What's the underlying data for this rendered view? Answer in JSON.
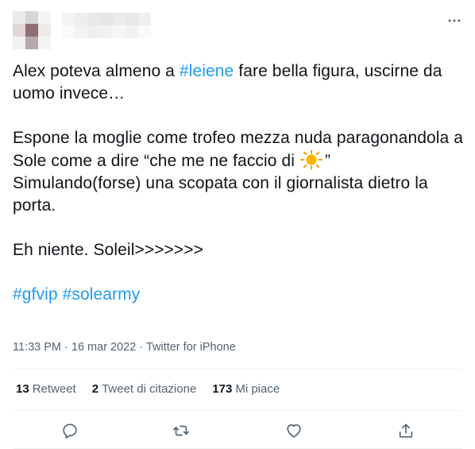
{
  "tweet": {
    "line1_before": "Alex poteva almeno a ",
    "line1_hashtag": "#leiene",
    "line1_after": " fare bella figura, uscirne da uomo invece…",
    "para2_text": "Espone la moglie come trofeo mezza nuda paragonandola a Sole come a dire “che me ne faccio di ",
    "para2_emoji_icon": "sun-emoji",
    "para2_after_emoji": "”",
    "para3_text": "Simulando(forse) una scopata con il giornalista dietro la porta.",
    "para4_text": "Eh niente. Soleil>>>>>>>",
    "hashtag1": "#gfvip",
    "hashtag2": "#solearmy"
  },
  "meta": {
    "time": "11:33 PM",
    "sep1": " · ",
    "date": "16 mar 2022",
    "sep2": " · ",
    "source": "Twitter for iPhone"
  },
  "stats": {
    "retweets_count": "13",
    "retweets_label": "Retweet",
    "quotes_count": "2",
    "quotes_label": "Tweet di citazione",
    "likes_count": "173",
    "likes_label": "Mi piace"
  },
  "icons": {
    "more": "more-horizontal-icon",
    "reply": "reply-icon",
    "retweet": "retweet-icon",
    "like": "heart-icon",
    "share": "share-icon"
  },
  "colors": {
    "hashtag": "#1d9bf0",
    "text": "#0f1419",
    "secondary": "#536471",
    "divider": "#eff3f4"
  }
}
